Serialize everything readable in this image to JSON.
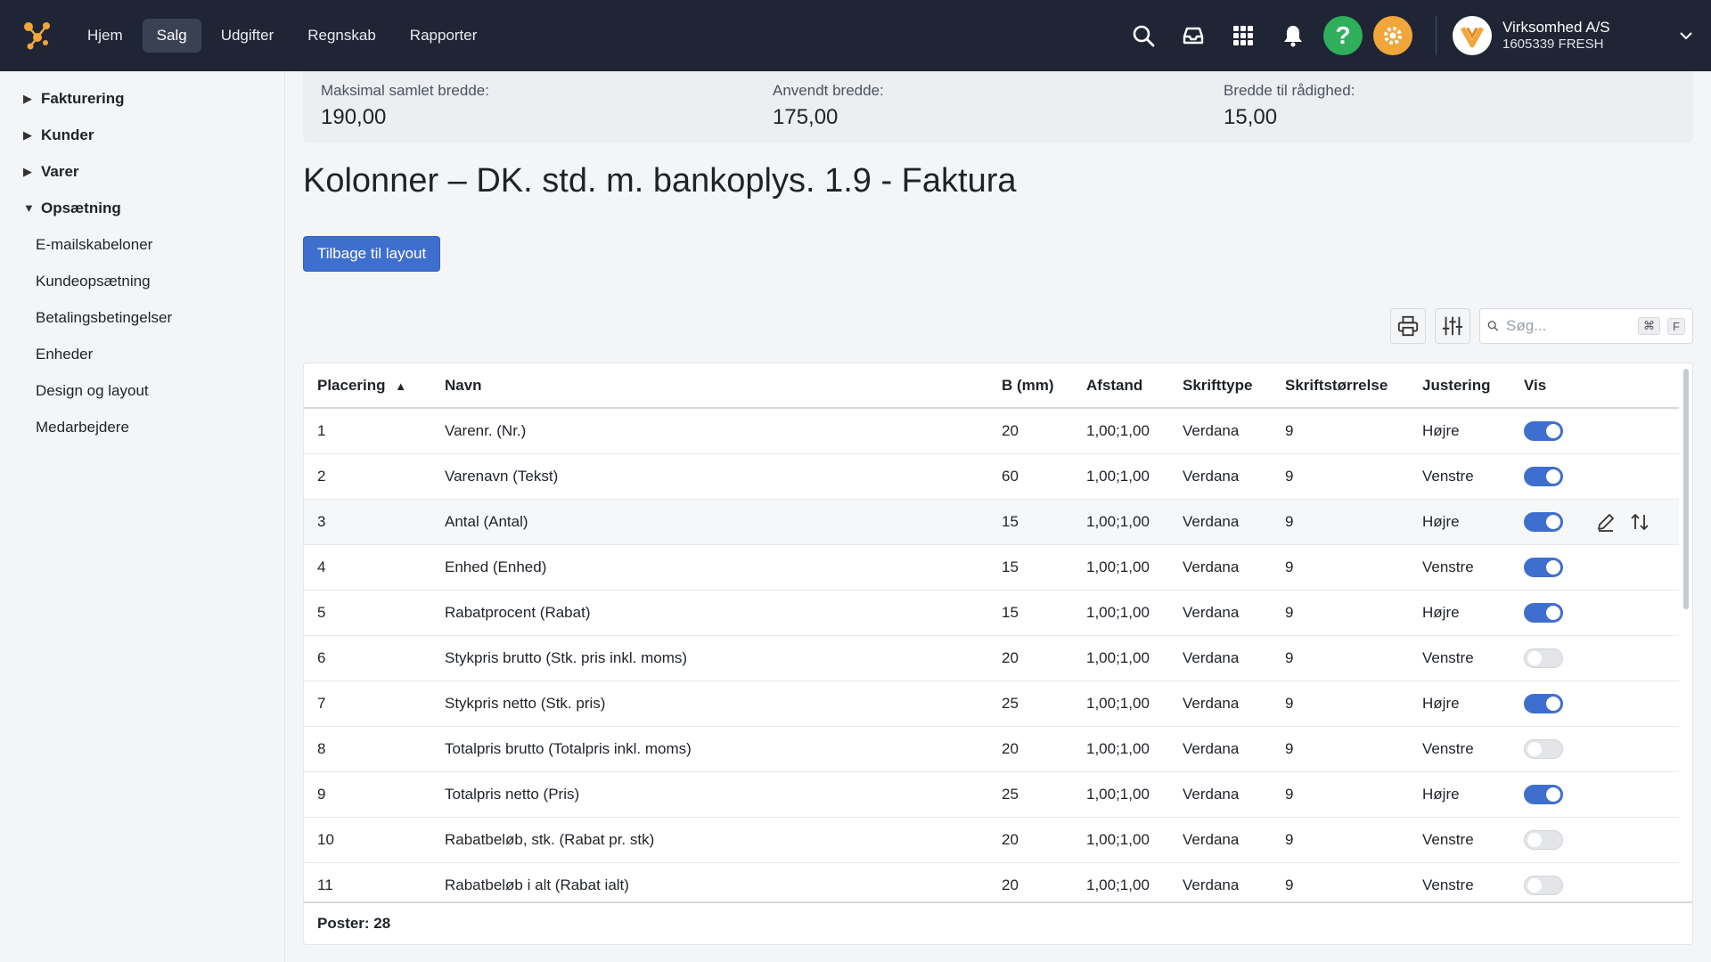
{
  "topbar": {
    "nav": [
      "Hjem",
      "Salg",
      "Udgifter",
      "Regnskab",
      "Rapporter"
    ],
    "active_nav": "Salg",
    "company_name": "Virksomhed A/S",
    "company_id": "1605339 FRESH",
    "help_label": "?"
  },
  "sidebar": {
    "groups": [
      {
        "label": "Fakturering",
        "expanded": false
      },
      {
        "label": "Kunder",
        "expanded": false
      },
      {
        "label": "Varer",
        "expanded": false
      },
      {
        "label": "Opsætning",
        "expanded": true
      }
    ],
    "items": [
      "E-mailskabeloner",
      "Kundeopsætning",
      "Betalingsbetingelser",
      "Enheder",
      "Design og layout",
      "Medarbejdere"
    ]
  },
  "stats": {
    "max_label": "Maksimal samlet bredde:",
    "max_value": "190,00",
    "used_label": "Anvendt bredde:",
    "used_value": "175,00",
    "available_label": "Bredde til rådighed:",
    "available_value": "15,00"
  },
  "page": {
    "title": "Kolonner – DK. std. m. bankoplys. 1.9 - Faktura",
    "back_button": "Tilbage til layout"
  },
  "search": {
    "placeholder": "Søg...",
    "kbd_cmd": "⌘",
    "kbd_key": "F"
  },
  "table": {
    "headers": [
      "Placering",
      "Navn",
      "B (mm)",
      "Afstand",
      "Skrifttype",
      "Skriftstørrelse",
      "Justering",
      "Vis"
    ],
    "rows": [
      {
        "pos": "1",
        "name": "Varenr. (Nr.)",
        "width": "20",
        "spacing": "1,00;1,00",
        "font": "Verdana",
        "size": "9",
        "align": "Højre",
        "visible": true
      },
      {
        "pos": "2",
        "name": "Varenavn (Tekst)",
        "width": "60",
        "spacing": "1,00;1,00",
        "font": "Verdana",
        "size": "9",
        "align": "Venstre",
        "visible": true
      },
      {
        "pos": "3",
        "name": "Antal (Antal)",
        "width": "15",
        "spacing": "1,00;1,00",
        "font": "Verdana",
        "size": "9",
        "align": "Højre",
        "visible": true
      },
      {
        "pos": "4",
        "name": "Enhed (Enhed)",
        "width": "15",
        "spacing": "1,00;1,00",
        "font": "Verdana",
        "size": "9",
        "align": "Venstre",
        "visible": true
      },
      {
        "pos": "5",
        "name": "Rabatprocent (Rabat)",
        "width": "15",
        "spacing": "1,00;1,00",
        "font": "Verdana",
        "size": "9",
        "align": "Højre",
        "visible": true
      },
      {
        "pos": "6",
        "name": "Stykpris brutto (Stk. pris inkl. moms)",
        "width": "20",
        "spacing": "1,00;1,00",
        "font": "Verdana",
        "size": "9",
        "align": "Venstre",
        "visible": false
      },
      {
        "pos": "7",
        "name": "Stykpris netto (Stk. pris)",
        "width": "25",
        "spacing": "1,00;1,00",
        "font": "Verdana",
        "size": "9",
        "align": "Højre",
        "visible": true
      },
      {
        "pos": "8",
        "name": "Totalpris brutto (Totalpris inkl. moms)",
        "width": "20",
        "spacing": "1,00;1,00",
        "font": "Verdana",
        "size": "9",
        "align": "Venstre",
        "visible": false
      },
      {
        "pos": "9",
        "name": "Totalpris netto (Pris)",
        "width": "25",
        "spacing": "1,00;1,00",
        "font": "Verdana",
        "size": "9",
        "align": "Højre",
        "visible": true
      },
      {
        "pos": "10",
        "name": "Rabatbeløb, stk. (Rabat pr. stk)",
        "width": "20",
        "spacing": "1,00;1,00",
        "font": "Verdana",
        "size": "9",
        "align": "Venstre",
        "visible": false
      },
      {
        "pos": "11",
        "name": "Rabatbeløb i alt (Rabat ialt)",
        "width": "20",
        "spacing": "1,00;1,00",
        "font": "Verdana",
        "size": "9",
        "align": "Venstre",
        "visible": false
      }
    ],
    "hover_row": 2,
    "footer": "Poster: 28"
  },
  "colors": {
    "topbar": "#1f2534",
    "accent": "#3f6fce",
    "help": "#2fae5c",
    "settings": "#f0a63a"
  }
}
